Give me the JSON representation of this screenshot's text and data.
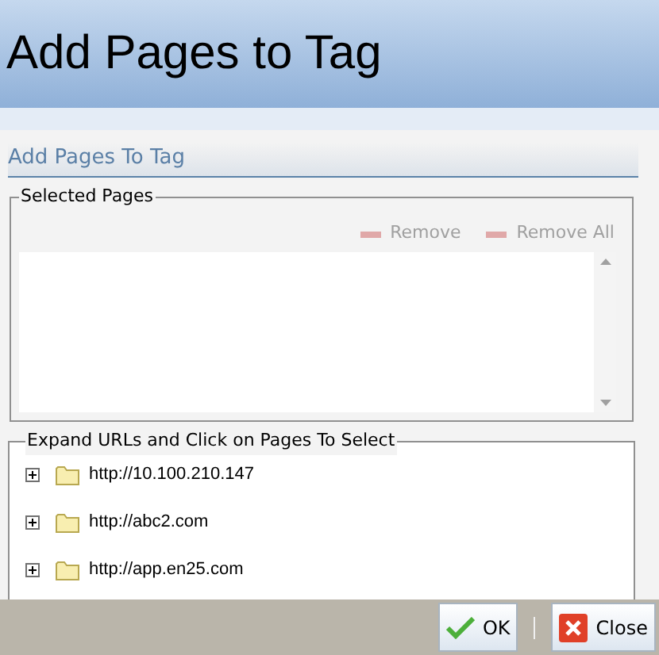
{
  "window": {
    "title": "Add Pages to Tag"
  },
  "section": {
    "title": "Add Pages To Tag"
  },
  "selected_pages": {
    "legend": "Selected Pages",
    "actions": [
      {
        "label": "Remove",
        "disabled": true
      },
      {
        "label": "Remove All",
        "disabled": true
      }
    ]
  },
  "tree": {
    "legend": "Expand URLs and Click on Pages To Select",
    "items": [
      {
        "label": "http://10.100.210.147",
        "expanded": false
      },
      {
        "label": "http://abc2.com",
        "expanded": false
      },
      {
        "label": "http://app.en25.com",
        "expanded": false
      }
    ]
  },
  "buttons": [
    {
      "kind": "ok",
      "label": "OK"
    },
    {
      "kind": "close",
      "label": "Close"
    }
  ]
}
